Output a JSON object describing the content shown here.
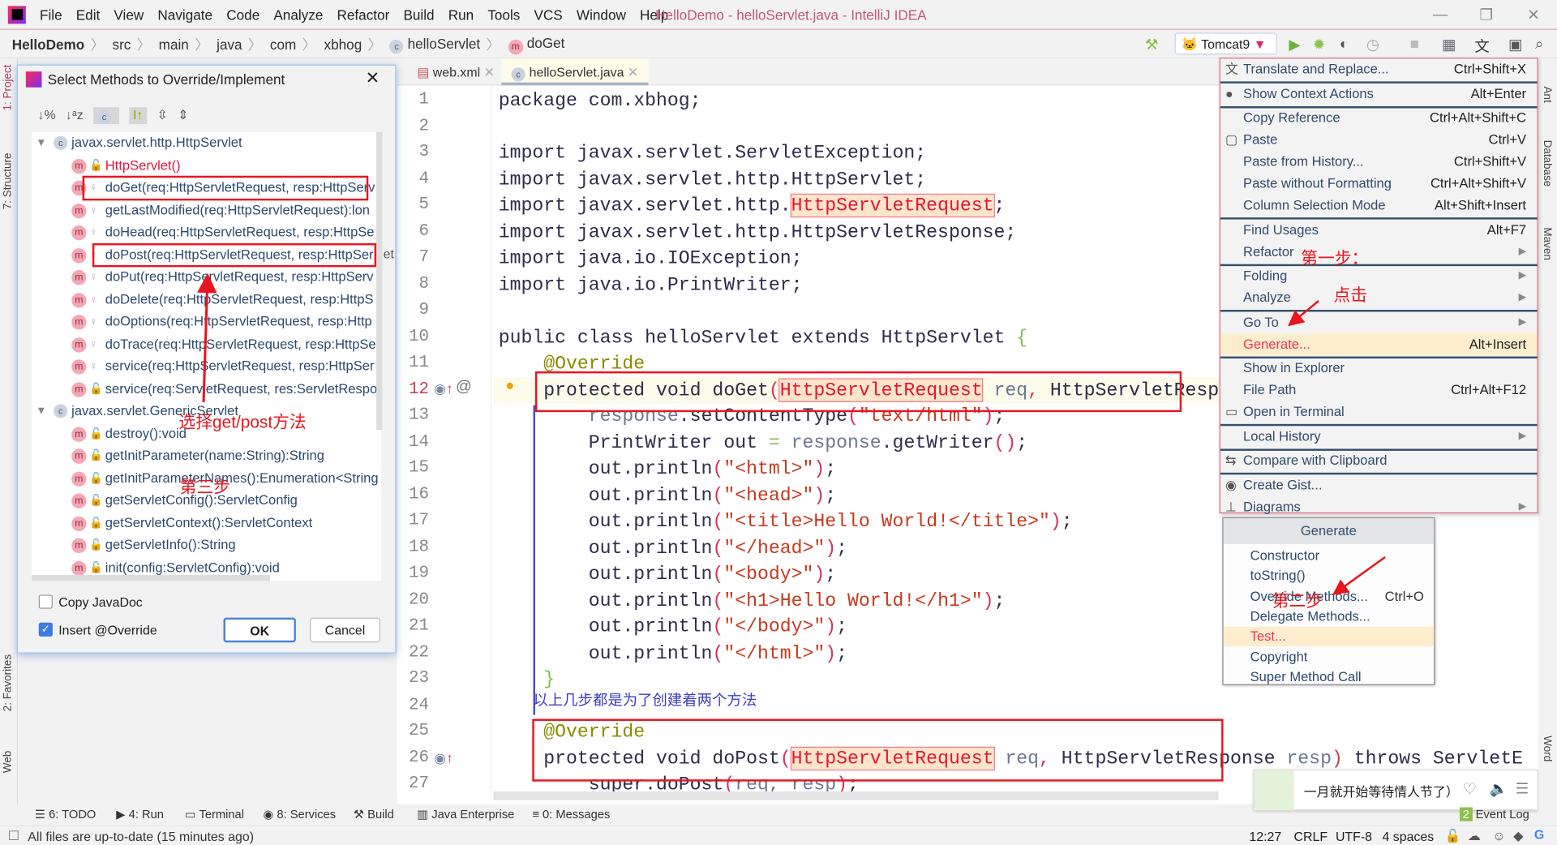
{
  "menu": {
    "items": [
      "File",
      "Edit",
      "View",
      "Navigate",
      "Code",
      "Analyze",
      "Refactor",
      "Build",
      "Run",
      "Tools",
      "VCS",
      "Window",
      "Help"
    ],
    "window_title": "HelloDemo - helloServlet.java - IntelliJ IDEA"
  },
  "breadcrumb": [
    "HelloDemo",
    "src",
    "main",
    "java",
    "com",
    "xbhog",
    "helloServlet",
    "doGet"
  ],
  "run_config": "Tomcat9",
  "tabs": [
    "web.xml",
    "helloServlet.java"
  ],
  "left_strip": [
    "1: Project",
    "7: Structure",
    "2: Favorites",
    "Web"
  ],
  "right_strip": [
    "Ant",
    "Database",
    "Maven",
    "Word"
  ],
  "dialog": {
    "title": "Select Methods to Override/Implement",
    "groups": [
      {
        "name": "javax.servlet.http.HttpServlet",
        "methods": [
          "HttpServlet()",
          "doGet(req:HttpServletRequest, resp:HttpServ",
          "getLastModified(req:HttpServletRequest):lon",
          "doHead(req:HttpServletRequest, resp:HttpSe",
          "doPost(req:HttpServletRequest, resp:HttpSer",
          "doPut(req:HttpServletRequest, resp:HttpServ",
          "doDelete(req:HttpServletRequest, resp:HttpS",
          "doOptions(req:HttpServletRequest, resp:Http",
          "doTrace(req:HttpServletRequest, resp:HttpSe",
          "service(req:HttpServletRequest, resp:HttpSer",
          "service(req:ServletRequest, res:ServletRespor"
        ]
      },
      {
        "name": "javax.servlet.GenericServlet",
        "methods": [
          "destroy():void",
          "getInitParameter(name:String):String",
          "getInitParameterNames():Enumeration<String",
          "getServletConfig():ServletConfig",
          "getServletContext():ServletContext",
          "getServletInfo():String",
          "init(config:ServletConfig):void"
        ]
      }
    ],
    "copy_javadoc": {
      "label": "Copy JavaDoc",
      "checked": false
    },
    "insert_override": {
      "label": "Insert @Override",
      "checked": true
    },
    "ok": "OK",
    "cancel": "Cancel",
    "overflow_text": "et"
  },
  "code": [
    {
      "n": 1,
      "t": [
        [
          "k",
          "package com.xbhog;"
        ]
      ]
    },
    {
      "n": 2,
      "t": []
    },
    {
      "n": 3,
      "t": [
        [
          "k",
          "import javax.servlet.ServletException;"
        ]
      ]
    },
    {
      "n": 4,
      "t": [
        [
          "k",
          "import javax.servlet.http.HttpServlet;"
        ]
      ]
    },
    {
      "n": 5,
      "t": [
        [
          "k",
          "import javax.servlet.http."
        ],
        [
          "t",
          "HttpServletRequest"
        ],
        [
          "k",
          ";"
        ]
      ]
    },
    {
      "n": 6,
      "t": [
        [
          "k",
          "import javax.servlet.http.HttpServletResponse;"
        ]
      ]
    },
    {
      "n": 7,
      "t": [
        [
          "k",
          "import java.io.IOException;"
        ]
      ]
    },
    {
      "n": 8,
      "t": [
        [
          "k",
          "import java.io.PrintWriter;"
        ]
      ]
    },
    {
      "n": 9,
      "t": []
    },
    {
      "n": 10,
      "t": [
        [
          "k",
          "public class helloServlet extends HttpServlet "
        ],
        [
          "g",
          "{"
        ]
      ]
    },
    {
      "n": 11,
      "t": [
        [
          "k",
          "    "
        ],
        [
          "a",
          "@Override"
        ]
      ]
    },
    {
      "n": 12,
      "t": [
        [
          "k",
          "    protected void doGet"
        ],
        [
          "p",
          "("
        ],
        [
          "t",
          "HttpServletRequest"
        ],
        [
          "v",
          " req"
        ],
        [
          "p",
          ","
        ],
        [
          "k",
          " HttpServletResp"
        ]
      ]
    },
    {
      "n": 13,
      "t": [
        [
          "v",
          "        response"
        ],
        [
          "k",
          ".setContentType"
        ],
        [
          "p",
          "("
        ],
        [
          "s",
          "\"text/html\""
        ],
        [
          "p",
          ")"
        ],
        [
          "k",
          ";"
        ]
      ]
    },
    {
      "n": 14,
      "t": [
        [
          "k",
          "        PrintWriter out "
        ],
        [
          "g",
          "="
        ],
        [
          "v",
          " response"
        ],
        [
          "k",
          ".getWriter"
        ],
        [
          "p",
          "()"
        ],
        [
          "k",
          ";"
        ]
      ]
    },
    {
      "n": 15,
      "t": [
        [
          "k",
          "        out.println"
        ],
        [
          "p",
          "("
        ],
        [
          "s",
          "\"<html>\""
        ],
        [
          "p",
          ")"
        ],
        [
          "k",
          ";"
        ]
      ]
    },
    {
      "n": 16,
      "t": [
        [
          "k",
          "        out.println"
        ],
        [
          "p",
          "("
        ],
        [
          "s",
          "\"<head>\""
        ],
        [
          "p",
          ")"
        ],
        [
          "k",
          ";"
        ]
      ]
    },
    {
      "n": 17,
      "t": [
        [
          "k",
          "        out.println"
        ],
        [
          "p",
          "("
        ],
        [
          "s",
          "\"<title>Hello World!</title>\""
        ],
        [
          "p",
          ")"
        ],
        [
          "k",
          ";"
        ]
      ]
    },
    {
      "n": 18,
      "t": [
        [
          "k",
          "        out.println"
        ],
        [
          "p",
          "("
        ],
        [
          "s",
          "\"</head>\""
        ],
        [
          "p",
          ")"
        ],
        [
          "k",
          ";"
        ]
      ]
    },
    {
      "n": 19,
      "t": [
        [
          "k",
          "        out.println"
        ],
        [
          "p",
          "("
        ],
        [
          "s",
          "\"<body>\""
        ],
        [
          "p",
          ")"
        ],
        [
          "k",
          ";"
        ]
      ]
    },
    {
      "n": 20,
      "t": [
        [
          "k",
          "        out.println"
        ],
        [
          "p",
          "("
        ],
        [
          "s",
          "\"<h1>Hello World!</h1>\""
        ],
        [
          "p",
          ")"
        ],
        [
          "k",
          ";"
        ]
      ]
    },
    {
      "n": 21,
      "t": [
        [
          "k",
          "        out.println"
        ],
        [
          "p",
          "("
        ],
        [
          "s",
          "\"</body>\""
        ],
        [
          "p",
          ")"
        ],
        [
          "k",
          ";"
        ]
      ]
    },
    {
      "n": 22,
      "t": [
        [
          "k",
          "        out.println"
        ],
        [
          "p",
          "("
        ],
        [
          "s",
          "\"</html>\""
        ],
        [
          "p",
          ")"
        ],
        [
          "k",
          ";"
        ]
      ]
    },
    {
      "n": 23,
      "t": [
        [
          "g",
          "    }"
        ]
      ]
    },
    {
      "n": 24,
      "t": []
    },
    {
      "n": 25,
      "t": [
        [
          "k",
          "    "
        ],
        [
          "a",
          "@Override"
        ]
      ]
    },
    {
      "n": 26,
      "t": [
        [
          "k",
          "    protected void doPost"
        ],
        [
          "p",
          "("
        ],
        [
          "t",
          "HttpServletRequest"
        ],
        [
          "v",
          " req"
        ],
        [
          "p",
          ","
        ],
        [
          "k",
          " HttpServletResponse "
        ],
        [
          "v",
          "resp"
        ],
        [
          "p",
          ")"
        ],
        [
          "k",
          " throws ServletE"
        ]
      ]
    },
    {
      "n": 27,
      "t": [
        [
          "k",
          "        super.doPost"
        ],
        [
          "p",
          "("
        ],
        [
          "v",
          "req, resp"
        ],
        [
          "p",
          ")"
        ],
        [
          "k",
          ";"
        ]
      ]
    }
  ],
  "context_menu": [
    {
      "label": "Translate and Replace...",
      "shortcut": "Ctrl+Shift+X",
      "icon": "translate-icon"
    },
    {
      "label": "Show Context Actions",
      "shortcut": "Alt+Enter",
      "icon": "bulb-icon"
    },
    {
      "label": "Copy Reference",
      "shortcut": "Ctrl+Alt+Shift+C"
    },
    {
      "label": "Paste",
      "shortcut": "Ctrl+V",
      "icon": "clipboard-icon"
    },
    {
      "label": "Paste from History...",
      "shortcut": "Ctrl+Shift+V"
    },
    {
      "label": "Paste without Formatting",
      "shortcut": "Ctrl+Alt+Shift+V"
    },
    {
      "label": "Column Selection Mode",
      "shortcut": "Alt+Shift+Insert"
    },
    {
      "label": "Find Usages",
      "shortcut": "Alt+F7"
    },
    {
      "label": "Refactor",
      "shortcut": "▶"
    },
    {
      "label": "Folding",
      "shortcut": "▶"
    },
    {
      "label": "Analyze",
      "shortcut": "▶"
    },
    {
      "label": "Go To",
      "shortcut": "▶"
    },
    {
      "label": "Generate...",
      "shortcut": "Alt+Insert",
      "highlighted": true
    },
    {
      "label": "Show in Explorer",
      "shortcut": ""
    },
    {
      "label": "File Path",
      "shortcut": "Ctrl+Alt+F12"
    },
    {
      "label": "Open in Terminal",
      "shortcut": "",
      "icon": "terminal-icon"
    },
    {
      "label": "Local History",
      "shortcut": "▶"
    },
    {
      "label": "Compare with Clipboard",
      "shortcut": "",
      "icon": "compare-icon"
    },
    {
      "label": "Create Gist...",
      "shortcut": "",
      "icon": "github-icon"
    },
    {
      "label": "Diagrams",
      "shortcut": "▶",
      "icon": "diagram-icon"
    }
  ],
  "generate_popup": {
    "title": "Generate",
    "items": [
      {
        "label": "Constructor"
      },
      {
        "label": "toString()"
      },
      {
        "label": "Override Methods...",
        "shortcut": "Ctrl+O"
      },
      {
        "label": "Delegate Methods..."
      },
      {
        "label": "Test...",
        "highlighted": true
      },
      {
        "label": "Copyright"
      },
      {
        "label": "Super Method Call"
      }
    ]
  },
  "annotations": {
    "step1": "第一步：",
    "click": "点击",
    "select": "选择get/post方法",
    "step3": "第三步",
    "step2": "第二步",
    "note": "以上几步都是为了创建着两个方法"
  },
  "tool_windows": [
    "6: TODO",
    "4: Run",
    "Terminal",
    "8: Services",
    "Build",
    "Java Enterprise",
    "0: Messages"
  ],
  "event_log": {
    "label": "Event Log",
    "count": "2"
  },
  "status": {
    "message": "All files are up-to-date (15 minutes ago)",
    "position": "12:27",
    "line_sep": "CRLF",
    "encoding": "UTF-8",
    "indent": "4 spaces"
  },
  "notification": {
    "text": "一月就开始等待情人节了）"
  },
  "colors": {
    "accent_red": "#e8151e",
    "highlight": "#fcedcc",
    "selection_text": "#f0335a"
  }
}
